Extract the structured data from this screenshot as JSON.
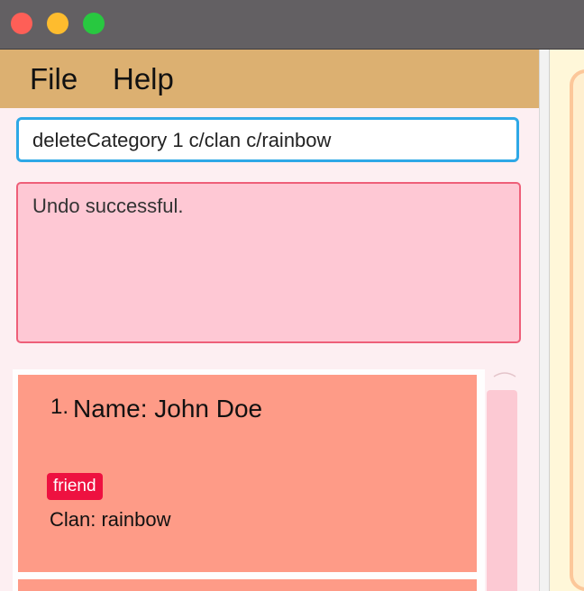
{
  "window": {
    "controls": [
      "close",
      "minimize",
      "maximize"
    ]
  },
  "menu": {
    "file_label": "File",
    "help_label": "Help"
  },
  "command": {
    "value": "deleteCategory 1 c/clan c/rainbow"
  },
  "result": {
    "message": "Undo successful."
  },
  "person_list": {
    "items": [
      {
        "index": "1.",
        "name": "Name: John Doe",
        "tags": [
          "friend"
        ],
        "clan": "Clan: rainbow"
      }
    ]
  },
  "colors": {
    "menubar": "#dcb071",
    "command_border": "#2ea8e6",
    "result_bg": "#fec8d4",
    "result_border": "#ee5f79",
    "card_bg": "#fe9b87",
    "tag_bg": "#ee1140",
    "scrollbar": "#fcc9d3",
    "right_pane": "#fff7d9"
  }
}
